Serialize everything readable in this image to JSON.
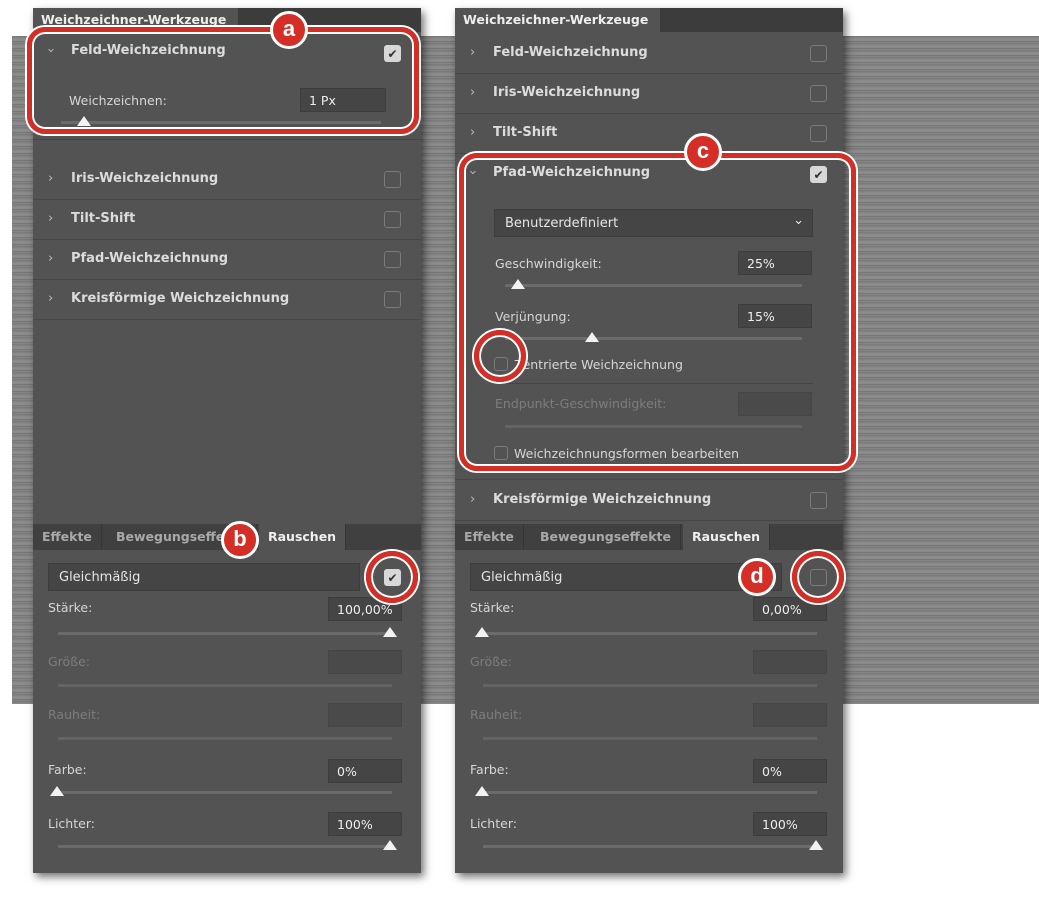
{
  "left_panel": {
    "title": "Weichzeichner-Werkzeuge",
    "feld": {
      "label": "Feld-Weichzeichnung",
      "checked": true,
      "blur_label": "Weichzeichnen:",
      "blur_value": "1 Px"
    },
    "rows": [
      {
        "label": "Iris-Weichzeichnung"
      },
      {
        "label": "Tilt-Shift"
      },
      {
        "label": "Pfad-Weichzeichnung"
      },
      {
        "label": "Kreisförmige Weichzeichnung"
      }
    ],
    "tabs": [
      "Effekte",
      "Bewegungseffekte",
      "Rauschen"
    ],
    "noise": {
      "type": "Gleichmäßig",
      "checked": true,
      "staerke_label": "Stärke:",
      "staerke": "100,00%",
      "groesse_label": "Größe:",
      "rauheit_label": "Rauheit:",
      "farbe_label": "Farbe:",
      "farbe": "0%",
      "lichter_label": "Lichter:",
      "lichter": "100%"
    }
  },
  "right_panel": {
    "title": "Weichzeichner-Werkzeuge",
    "rows_top": [
      {
        "label": "Feld-Weichzeichnung"
      },
      {
        "label": "Iris-Weichzeichnung"
      },
      {
        "label": "Tilt-Shift"
      }
    ],
    "pfad": {
      "label": "Pfad-Weichzeichnung",
      "checked": true,
      "preset": "Benutzerdefiniert",
      "speed_label": "Geschwindigkeit:",
      "speed": "25%",
      "taper_label": "Verjüngung:",
      "taper": "15%",
      "centered_label": "Zentrierte Weichzeichnung",
      "endpoint_label": "Endpunkt-Geschwindigkeit:",
      "edit_shapes_label": "Weichzeichnungsformen bearbeiten"
    },
    "kreis": {
      "label": "Kreisförmige Weichzeichnung"
    },
    "tabs": [
      "Effekte",
      "Bewegungseffekte",
      "Rauschen"
    ],
    "noise": {
      "type": "Gleichmäßig",
      "checked": false,
      "staerke_label": "Stärke:",
      "staerke": "0,00%",
      "groesse_label": "Größe:",
      "rauheit_label": "Rauheit:",
      "farbe_label": "Farbe:",
      "farbe": "0%",
      "lichter_label": "Lichter:",
      "lichter": "100%"
    }
  },
  "annotations": {
    "a": "a",
    "b": "b",
    "c": "c",
    "d": "d"
  },
  "icons": {
    "chevron": "›",
    "chevron_down": "⌄",
    "check": "✔"
  },
  "colors": {
    "annotation": "#d42e26",
    "panel": "#535353"
  }
}
